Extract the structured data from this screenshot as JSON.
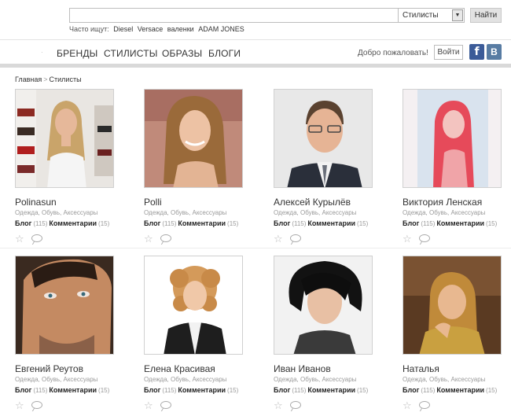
{
  "search": {
    "value": "",
    "category": "Стилисты",
    "button": "Найти"
  },
  "popular": {
    "label": "Часто ищут:",
    "queries": [
      "Diesel",
      "Versace",
      "валенки",
      "ADAM JONES"
    ]
  },
  "nav": {
    "items": [
      "БРЕНДЫ",
      "СТИЛИСТЫ",
      "ОБРАЗЫ",
      "БЛОГИ"
    ],
    "welcome": "Добро пожаловать!",
    "login": "Войти",
    "facebook": "f",
    "vkontakte": "B"
  },
  "breadcrumb": {
    "home": "Главная",
    "sep": ">",
    "current": "Стилисты"
  },
  "stylists": [
    {
      "name": "Polinasun",
      "cats": "Одежда, Обувь, Аксессуары",
      "blog": "Блог",
      "blog_count": "(115)",
      "comments": "Комментарии",
      "comments_count": "(15)"
    },
    {
      "name": "Polli",
      "cats": "Одежда, Обувь, Аксессуары",
      "blog": "Блог",
      "blog_count": "(115)",
      "comments": "Комментарии",
      "comments_count": "(15)"
    },
    {
      "name": "Алексей Курылёв",
      "cats": "Одежда, Обувь, Аксессуары",
      "blog": "Блог",
      "blog_count": "(115)",
      "comments": "Комментарии",
      "comments_count": "(15)"
    },
    {
      "name": "Виктория Ленская",
      "cats": "Одежда, Обувь, Аксессуары",
      "blog": "Блог",
      "blog_count": "(115)",
      "comments": "Комментарии",
      "comments_count": "(15)"
    },
    {
      "name": "Евгений Реутов",
      "cats": "Одежда, Обувь, Аксессуары",
      "blog": "Блог",
      "blog_count": "(115)",
      "comments": "Комментарии",
      "comments_count": "(15)"
    },
    {
      "name": "Елена Красивая",
      "cats": "Одежда, Обувь, Аксессуары",
      "blog": "Блог",
      "blog_count": "(115)",
      "comments": "Комментарии",
      "comments_count": "(15)"
    },
    {
      "name": "Иван Иванов",
      "cats": "Одежда, Обувь, Аксессуары",
      "blog": "Блог",
      "blog_count": "(115)",
      "comments": "Комментарии",
      "comments_count": "(15)"
    },
    {
      "name": "Наталья",
      "cats": "Одежда, Обувь, Аксессуары",
      "blog": "Блог",
      "blog_count": "(115)",
      "comments": "Комментарии",
      "comments_count": "(15)"
    }
  ],
  "icons": {
    "favorite": "star-icon",
    "comment": "comment-bubble-icon",
    "dropdown": "chevron-down-icon"
  },
  "colors": {
    "facebook": "#3b5b98",
    "vkontakte": "#587ca3"
  }
}
